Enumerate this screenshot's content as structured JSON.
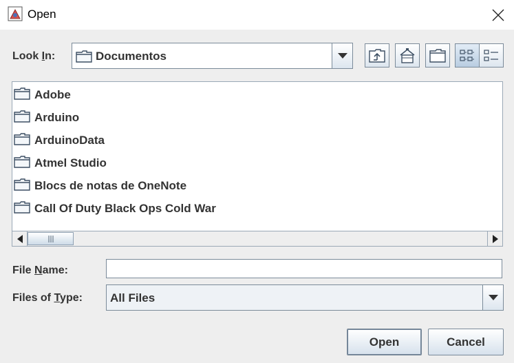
{
  "window": {
    "title": "Open"
  },
  "look_in": {
    "label_prefix": "Look ",
    "label_mnemonic": "I",
    "label_suffix": "n:",
    "value": "Documentos"
  },
  "toolbar": {
    "up_folder": "up-one-level-icon",
    "home": "home-icon",
    "new_folder": "new-folder-icon",
    "list_view": "list-view-icon",
    "details_view": "details-view-icon",
    "active_view": "list"
  },
  "files": [
    {
      "name": "Adobe",
      "icon": "folder-icon"
    },
    {
      "name": "Arduino",
      "icon": "folder-icon"
    },
    {
      "name": "ArduinoData",
      "icon": "folder-icon"
    },
    {
      "name": "Atmel Studio",
      "icon": "folder-icon"
    },
    {
      "name": "Blocs de notas de OneNote",
      "icon": "folder-icon"
    },
    {
      "name": "Call Of Duty Black Ops Cold War",
      "icon": "folder-icon"
    }
  ],
  "file_name": {
    "label_prefix": "File ",
    "label_mnemonic": "N",
    "label_suffix": "ame:",
    "value": "",
    "placeholder": ""
  },
  "file_type": {
    "label_prefix": "Files of ",
    "label_mnemonic": "T",
    "label_suffix": "ype:",
    "value": "All Files"
  },
  "buttons": {
    "open": "Open",
    "cancel": "Cancel"
  },
  "colors": {
    "accent": "#b9cde1",
    "border": "#7a8a99",
    "background": "#eeeeee"
  }
}
